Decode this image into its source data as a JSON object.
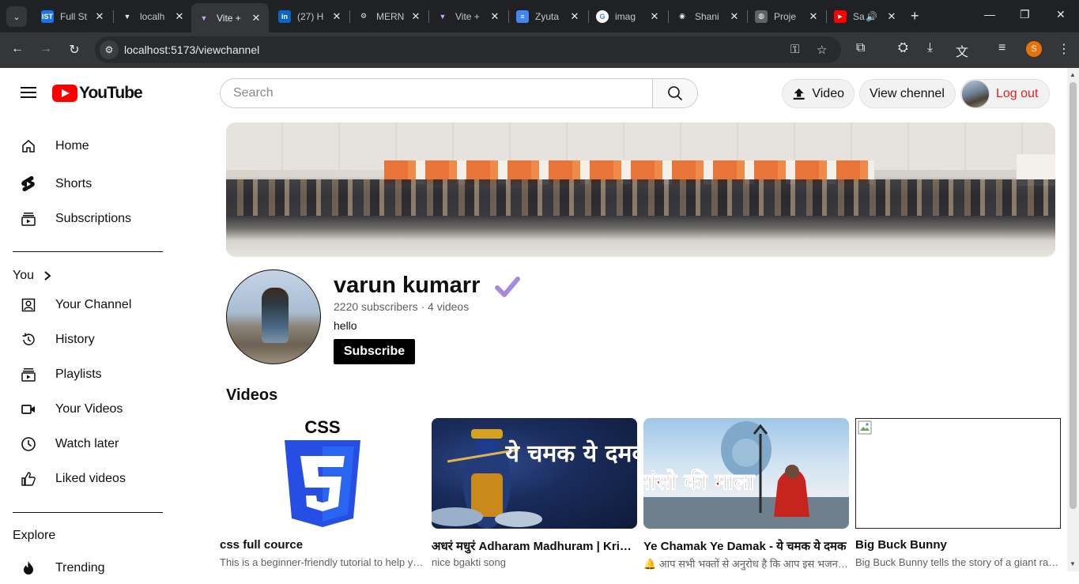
{
  "browser": {
    "tabs": [
      {
        "title": "Full St",
        "favicon_text": "IST",
        "favicon_color": "#1a73e8",
        "active": false
      },
      {
        "title": "localh",
        "favicon_text": "▼",
        "favicon_color": "#202124",
        "active": false
      },
      {
        "title": "Vite +",
        "favicon_text": "▼",
        "favicon_color": "#8c5cf6",
        "active": true
      },
      {
        "title": "(27) H",
        "favicon_text": "in",
        "favicon_color": "#0a66c2",
        "active": false
      },
      {
        "title": "MERN",
        "favicon_text": "⚙",
        "favicon_color": "#202124",
        "active": false
      },
      {
        "title": "Vite +",
        "favicon_text": "▼",
        "favicon_color": "#8c5cf6",
        "active": false
      },
      {
        "title": "Zyuta",
        "favicon_text": "≡",
        "favicon_color": "#4285f4",
        "active": false
      },
      {
        "title": "imag",
        "favicon_text": "G",
        "favicon_color": "#ffffff",
        "active": false
      },
      {
        "title": "Shani",
        "favicon_text": "◉",
        "favicon_color": "#202124",
        "active": false
      },
      {
        "title": "Proje",
        "favicon_text": "◍",
        "favicon_color": "#5f6368",
        "active": false
      },
      {
        "title": "Sa",
        "favicon_text": "▶",
        "favicon_color": "#ff0000",
        "active": false
      }
    ],
    "url": "localhost:5173/viewchannel",
    "profile_initial": "S"
  },
  "header": {
    "logo_text": "YouTube",
    "search_placeholder": "Search",
    "video_button": "Video",
    "view_channel_button": "View chennel",
    "logout_button": "Log out"
  },
  "sidebar": {
    "items": [
      {
        "label": "Home",
        "icon": "home-icon"
      },
      {
        "label": "Shorts",
        "icon": "shorts-icon"
      },
      {
        "label": "Subscriptions",
        "icon": "subscriptions-icon"
      }
    ],
    "you_heading": "You",
    "you_items": [
      {
        "label": "Your Channel",
        "icon": "your-channel-icon"
      },
      {
        "label": "History",
        "icon": "history-icon"
      },
      {
        "label": "Playlists",
        "icon": "playlists-icon"
      },
      {
        "label": "Your Videos",
        "icon": "your-videos-icon"
      },
      {
        "label": "Watch later",
        "icon": "watch-later-icon"
      },
      {
        "label": "Liked videos",
        "icon": "liked-videos-icon"
      }
    ],
    "explore_heading": "Explore",
    "explore_items": [
      {
        "label": "Trending",
        "icon": "trending-icon"
      }
    ]
  },
  "channel": {
    "name": "varun kumarr",
    "meta": "2220 subscribers · 4 videos",
    "description": "hello",
    "subscribe_button": "Subscribe",
    "verified_color": "#a78bda"
  },
  "videos": {
    "heading": "Videos",
    "items": [
      {
        "title": "css full cource",
        "description": "This is a beginner-friendly tutorial to help you learn CSS",
        "thumb_text": "CSS"
      },
      {
        "title": "अधरं मधुरं Adharam Madhuram | Krishna Bhajan",
        "description": "nice bgakti song",
        "thumb_text": "ये चमक ये दमक"
      },
      {
        "title": "Ye Chamak Ye Damak - ये चमक ये दमक",
        "description": "🔔 आप सभी भक्तों से अनुरोध है कि आप इस भजन को",
        "thumb_text": "सांसो की माला"
      },
      {
        "title": "Big Buck Bunny",
        "description": "Big Buck Bunny tells the story of a giant rabbit",
        "thumb_text": ""
      }
    ]
  }
}
